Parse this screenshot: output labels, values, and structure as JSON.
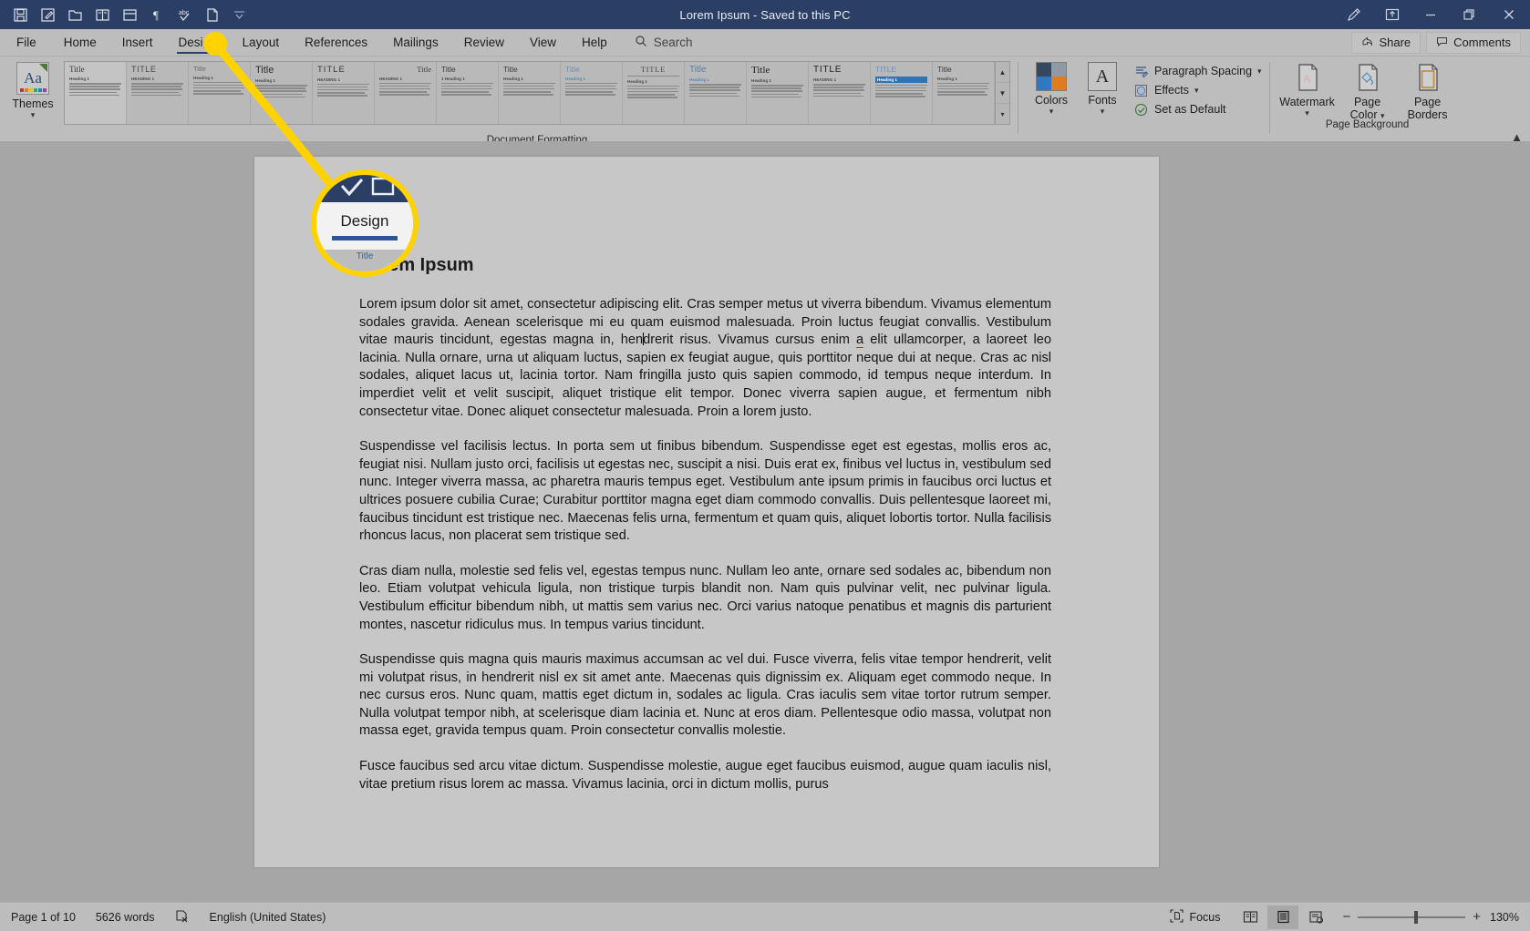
{
  "window": {
    "title": "Lorem Ipsum  -  Saved to this PC",
    "quick_access": [
      {
        "name": "save-icon",
        "label": "Save"
      },
      {
        "name": "autosave-icon",
        "label": "AutoSave"
      },
      {
        "name": "open-folder-icon",
        "label": "Open"
      },
      {
        "name": "read-mode-icon",
        "label": "Read Mode"
      },
      {
        "name": "print-layout-icon",
        "label": "Print Layout"
      },
      {
        "name": "paragraph-marks-icon",
        "label": "Show/Hide ¶"
      },
      {
        "name": "spelling-check-icon",
        "label": "Spelling & Grammar"
      },
      {
        "name": "new-document-icon",
        "label": "New"
      },
      {
        "name": "customize-qat-icon",
        "label": "Customize Quick Access Toolbar"
      }
    ],
    "controls": [
      {
        "name": "pen-icon",
        "label": "Draw"
      },
      {
        "name": "ribbon-display-options-icon",
        "label": "Ribbon Display Options"
      },
      {
        "name": "minimize-icon",
        "label": "Minimize"
      },
      {
        "name": "restore-icon",
        "label": "Restore Down"
      },
      {
        "name": "close-icon",
        "label": "Close"
      }
    ]
  },
  "tabs": [
    {
      "label": "File",
      "active": false
    },
    {
      "label": "Home",
      "active": false
    },
    {
      "label": "Insert",
      "active": false
    },
    {
      "label": "Design",
      "active": true
    },
    {
      "label": "Layout",
      "active": false
    },
    {
      "label": "References",
      "active": false
    },
    {
      "label": "Mailings",
      "active": false
    },
    {
      "label": "Review",
      "active": false
    },
    {
      "label": "View",
      "active": false
    },
    {
      "label": "Help",
      "active": false
    }
  ],
  "search": {
    "placeholder": "Search",
    "value": ""
  },
  "share": {
    "share_label": "Share",
    "comments_label": "Comments"
  },
  "ribbon": {
    "themes": {
      "label": "Themes"
    },
    "gallery_caption": "Document Formatting",
    "gallery_items": [
      {
        "title": "Title",
        "heading": "Heading 1",
        "title_style": "plain-serif",
        "selected": true
      },
      {
        "title": "TITLE",
        "heading": "HEADING 1",
        "title_style": "caps-light"
      },
      {
        "title": "Title",
        "heading": "Heading 1",
        "title_style": "gray-small"
      },
      {
        "title": "Title",
        "heading": "Heading 1",
        "title_style": "bold-large"
      },
      {
        "title": "TITLE",
        "heading": "HEADING 1",
        "title_style": "caps-wide"
      },
      {
        "title": "Title",
        "heading": "HEADING 1",
        "title_style": "right-serif"
      },
      {
        "title": "Title",
        "heading": "1  Heading 1",
        "title_style": "numbered"
      },
      {
        "title": "Title",
        "heading": "Heading 1",
        "title_style": "plain"
      },
      {
        "title": "Title",
        "heading": "Heading 1",
        "title_style": "light-blue"
      },
      {
        "title": "TITLE",
        "heading": "Heading 1",
        "title_style": "ruled-caps"
      },
      {
        "title": "Title",
        "heading": "Heading 1",
        "title_style": "blue-tall"
      },
      {
        "title": "Title",
        "heading": "Heading 1",
        "title_style": "big-black"
      },
      {
        "title": "TITLE",
        "heading": "HEADING 1",
        "title_style": "caps-black"
      },
      {
        "title": "TITLE",
        "heading": "Heading 1",
        "title_style": "blue-banner"
      },
      {
        "title": "Title",
        "heading": "Heading 1",
        "title_style": "plain-last"
      }
    ],
    "colors": {
      "label": "Colors",
      "swatches": [
        "#34495e",
        "#8f9aa5",
        "#2f78c4",
        "#e07b21"
      ]
    },
    "fonts": {
      "label": "Fonts",
      "glyph": "A"
    },
    "paragraph_spacing": {
      "label": "Paragraph Spacing"
    },
    "effects": {
      "label": "Effects"
    },
    "set_as_default": {
      "label": "Set as Default"
    },
    "page_background": {
      "caption": "Page Background",
      "watermark": "Watermark",
      "page_color": "Page\nColor",
      "page_color_l1": "Page",
      "page_color_l2": "Color",
      "page_borders_l1": "Page",
      "page_borders_l2": "Borders"
    }
  },
  "callout": {
    "tab_label": "Design",
    "thumb_label": "Title"
  },
  "document": {
    "heading": "Lorem Ipsum",
    "paragraphs": [
      "Lorem ipsum dolor sit amet, consectetur adipiscing elit. Cras semper metus ut viverra bibendum. Vivamus elementum sodales gravida. Aenean scelerisque mi eu quam euismod malesuada. Proin luctus feugiat convallis. Vestibulum vitae mauris tincidunt, egestas magna in, hendrerit risus. Vivamus cursus enim a elit ullamcorper, a laoreet leo lacinia. Nulla ornare, urna ut aliquam luctus, sapien ex feugiat augue, quis porttitor neque dui at neque. Cras ac nisl sodales, aliquet lacus ut, lacinia tortor. Nam fringilla justo quis sapien commodo, id tempus neque interdum. In imperdiet velit et velit suscipit, aliquet tristique elit tempor. Donec viverra sapien augue, et fermentum nibh consectetur vitae. Donec aliquet consectetur malesuada. Proin a lorem justo.",
      "Suspendisse vel facilisis lectus. In porta sem ut finibus bibendum. Suspendisse eget est egestas, mollis eros ac, feugiat nisi. Nullam justo orci, facilisis ut egestas nec, suscipit a nisi. Duis erat ex, finibus vel luctus in, vestibulum sed nunc. Integer viverra massa, ac pharetra mauris tempus eget. Vestibulum ante ipsum primis in faucibus orci luctus et ultrices posuere cubilia Curae; Curabitur porttitor magna eget diam commodo convallis. Duis pellentesque laoreet mi, faucibus tincidunt est tristique nec. Maecenas felis urna, fermentum et quam quis, aliquet lobortis tortor. Nulla facilisis rhoncus lacus, non placerat sem tristique sed.",
      "Cras diam nulla, molestie sed felis vel, egestas tempus nunc. Nullam leo ante, ornare sed sodales ac, bibendum non leo. Etiam volutpat vehicula ligula, non tristique turpis blandit non. Nam quis pulvinar velit, nec pulvinar ligula. Vestibulum efficitur bibendum nibh, ut mattis sem varius nec. Orci varius natoque penatibus et magnis dis parturient montes, nascetur ridiculus mus. In tempus varius tincidunt.",
      "Suspendisse quis magna quis mauris maximus accumsan ac vel dui. Fusce viverra, felis vitae tempor hendrerit, velit mi volutpat risus, in hendrerit nisl ex sit amet ante. Maecenas quis dignissim ex. Aliquam eget commodo neque. In nec cursus eros. Nunc quam, mattis eget dictum in, sodales ac ligula. Cras iaculis sem vitae tortor rutrum semper. Nulla volutpat tempor nibh, at scelerisque diam lacinia et. Nunc at eros diam. Pellentesque odio massa, volutpat non massa eget, gravida tempus quam. Proin consectetur convallis molestie.",
      "Fusce faucibus sed arcu vitae dictum. Suspendisse molestie, augue eget faucibus euismod, augue quam iaculis nisl, vitae pretium risus lorem ac massa. Vivamus lacinia, orci in dictum mollis, purus"
    ]
  },
  "statusbar": {
    "page": "Page 1 of 10",
    "words": "5626 words",
    "proofing_icon": "proofing-errors-icon",
    "language": "English (United States)",
    "focus": "Focus",
    "views": [
      {
        "name": "read-mode-view",
        "active": false
      },
      {
        "name": "print-layout-view",
        "active": true
      },
      {
        "name": "web-layout-view",
        "active": false
      }
    ],
    "zoom": "130%",
    "zoom_out": "−",
    "zoom_in": "+"
  }
}
